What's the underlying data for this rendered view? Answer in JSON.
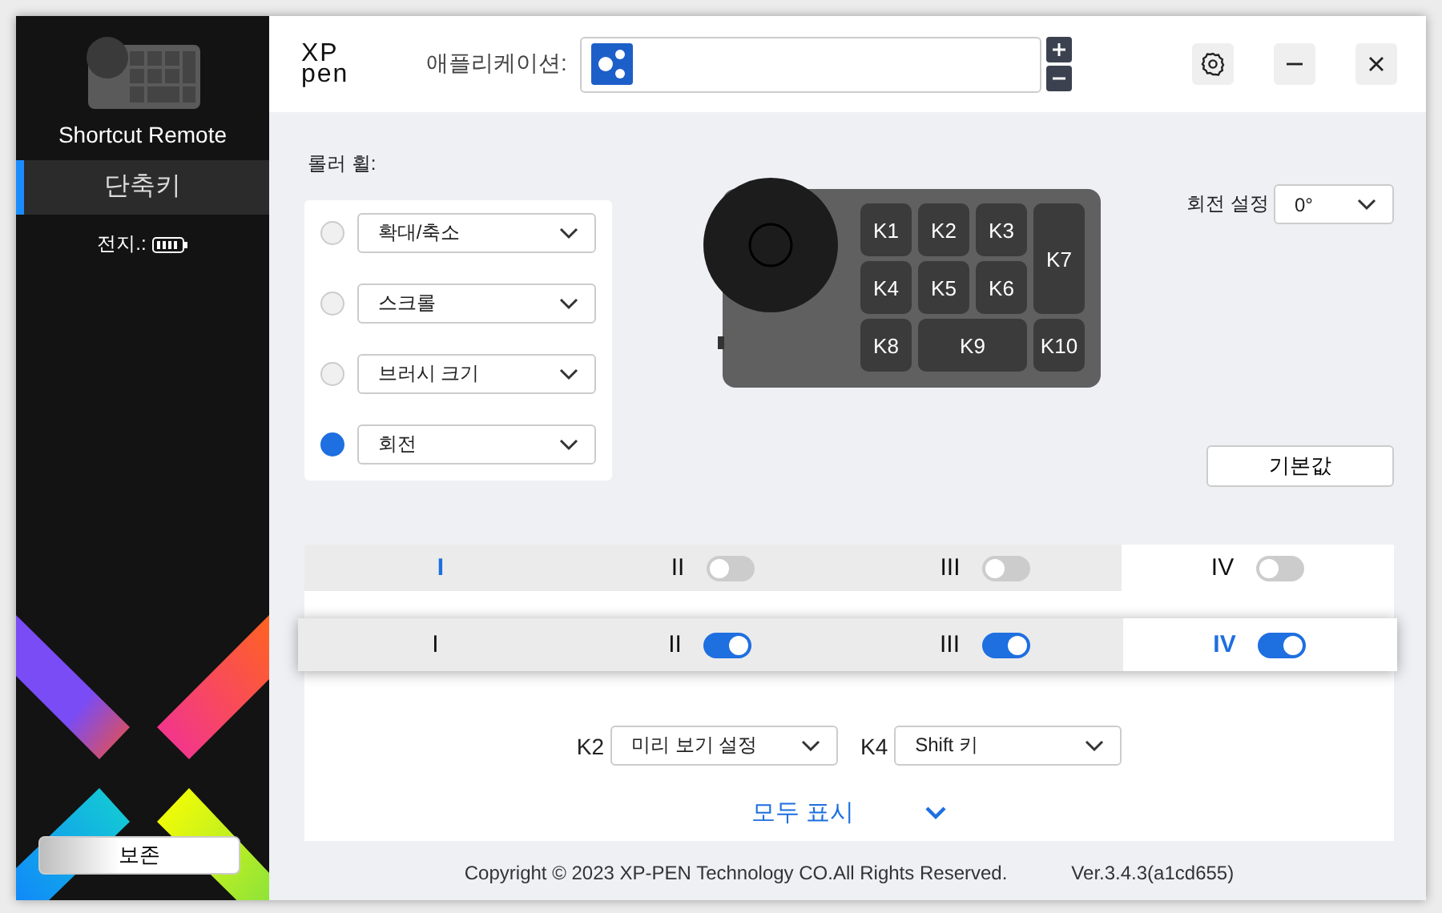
{
  "sidebar": {
    "device_name": "Shortcut Remote",
    "nav_items": [
      {
        "label": "단축키",
        "selected": true
      }
    ],
    "battery_label": "전지.:",
    "save_button": "보존"
  },
  "header": {
    "logo_lines": [
      "XP",
      "pen"
    ],
    "app_label": "애플리케이션:"
  },
  "roller": {
    "title": "롤러 휠:",
    "options": [
      {
        "label": "확대/축소",
        "selected": false
      },
      {
        "label": "스크롤",
        "selected": false
      },
      {
        "label": "브러시 크기",
        "selected": false
      },
      {
        "label": "회전",
        "selected": true
      }
    ]
  },
  "rotation": {
    "label": "회전 설정",
    "value": "0°"
  },
  "device_keys": [
    "K1",
    "K2",
    "K3",
    "K4",
    "K5",
    "K6",
    "K7",
    "K8",
    "K9",
    "K10"
  ],
  "default_button": "기본값",
  "mode_strips": [
    {
      "kind": "bar",
      "tabs": [
        {
          "label": "I",
          "selected": true,
          "hovered": false
        },
        {
          "label": "II",
          "selected": false,
          "hovered": false,
          "on": false
        },
        {
          "label": "III",
          "selected": false,
          "hovered": false,
          "on": false
        },
        {
          "label": "IV",
          "selected": false,
          "hovered": true,
          "on": false
        }
      ]
    },
    {
      "kind": "popup",
      "tabs": [
        {
          "label": "I",
          "selected": false,
          "hovered": false
        },
        {
          "label": "II",
          "selected": false,
          "hovered": false,
          "on": true
        },
        {
          "label": "III",
          "selected": false,
          "hovered": false,
          "on": true
        },
        {
          "label": "IV",
          "selected": true,
          "hovered": true,
          "on": true
        }
      ]
    }
  ],
  "key_assignments": [
    {
      "key": "K2",
      "value": "미리 보기 설정"
    },
    {
      "key": "K4",
      "value": "Shift 키"
    }
  ],
  "show_all": "모두 표시",
  "footer": {
    "copyright": "Copyright © 2023  XP-PEN Technology CO.All Rights Reserved.",
    "version": "Ver.3.4.3(a1cd655)"
  }
}
